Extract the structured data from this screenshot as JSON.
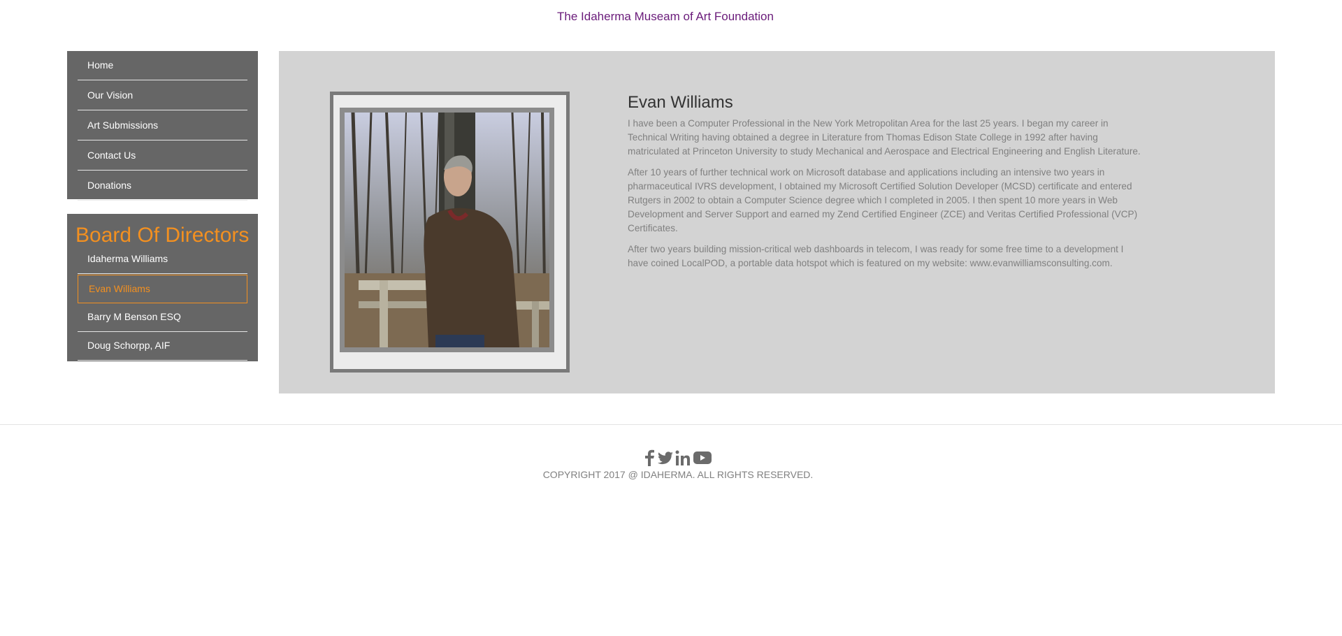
{
  "site": {
    "title": "The Idaherma Museam of Art Foundation"
  },
  "nav": {
    "items": [
      {
        "label": "Home"
      },
      {
        "label": "Our Vision"
      },
      {
        "label": "Art Submissions"
      },
      {
        "label": "Contact Us"
      },
      {
        "label": "Donations"
      }
    ]
  },
  "board": {
    "title": "Board Of Directors",
    "members": [
      {
        "label": "Idaherma Williams"
      },
      {
        "label": "Evan Williams"
      },
      {
        "label": "Barry M Benson ESQ"
      },
      {
        "label": "Doug Schorpp, AIF"
      }
    ],
    "active_member": "Evan Williams"
  },
  "profile": {
    "name": "Evan Williams",
    "paragraphs": [
      "I have been a Computer Professional in the New York Metropolitan Area for the last 25 years. I began my career in Technical Writing having obtained a degree in Literature from Thomas Edison State College in 1992 after having matriculated at Princeton University to study Mechanical and Aerospace and Electrical Engineering and English Literature.",
      "After 10 years of further technical work on Microsoft database and applications including an intensive two years in pharmaceutical IVRS development, I obtained my Microsoft Certified Solution Developer (MCSD) certificate and entered Rutgers in 2002 to obtain a Computer Science degree which I completed in 2005. I then spent 10 more years in Web Development and Server Support and earned my Zend Certified Engineer (ZCE) and Veritas Certified Professional (VCP) Certificates.",
      "After two years building mission-critical web dashboards  in telecom, I was ready for some free time to a development I have coined LocalPOD, a portable data hotspot which is featured on my website: www.evanwilliamsconsulting.com."
    ]
  },
  "footer": {
    "social_icons": [
      "facebook-icon",
      "twitter-icon",
      "linkedin-icon",
      "youtube-icon"
    ],
    "copyright": "COPYRIGHT 2017 @ IDAHERMA. ALL RIGHTS RESERVED."
  },
  "colors": {
    "title": "#6a1b7a",
    "nav_bg": "#666666",
    "accent": "#f39020",
    "panel_bg": "#d3d3d3",
    "body_text": "#808080"
  }
}
